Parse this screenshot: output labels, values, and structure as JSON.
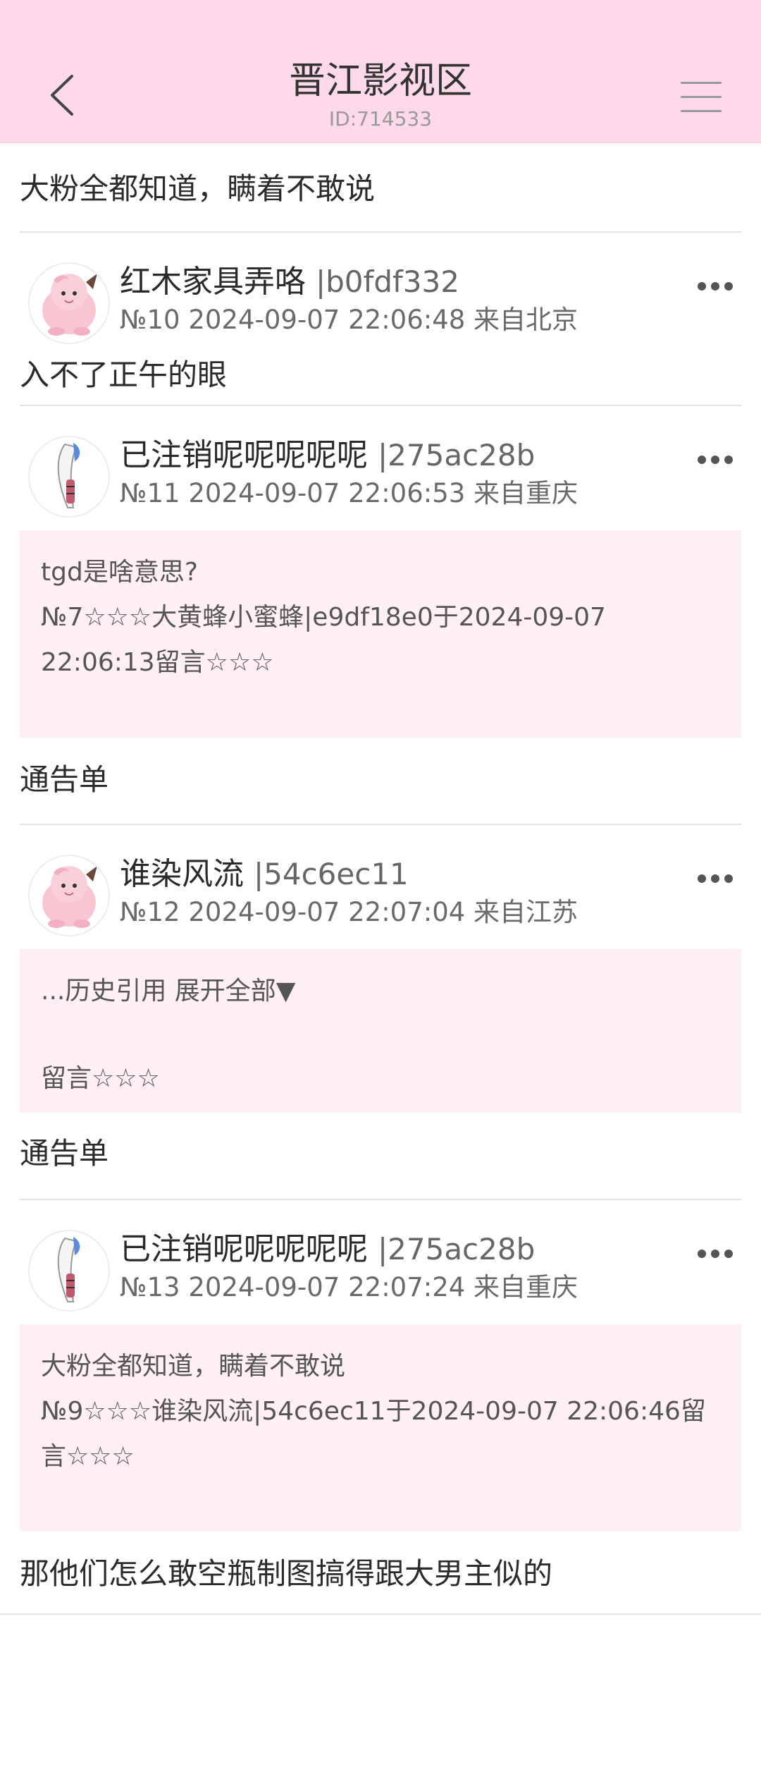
{
  "header": {
    "title": "晋江影视区",
    "id_text": "ID:714533"
  },
  "first_text": "大粉全都知道，瞒着不敢说",
  "posts": [
    {
      "name": "红木家具弄咯",
      "hash": "|b0fdf332",
      "meta": "№10 2024-09-07 22:06:48 来自北京",
      "body": "入不了正午的眼"
    },
    {
      "name": "已注销呢呢呢呢呢",
      "hash": "|275ac28b",
      "meta": "№11 2024-09-07 22:06:53 来自重庆",
      "quote_line1": "tgd是啥意思?",
      "quote_line2": "№7☆☆☆大黄蜂小蜜蜂|e9df18e0于2024-09-07",
      "quote_line3": "22:06:13留言☆☆☆",
      "body": "通告单"
    },
    {
      "name": "谁染风流",
      "hash": "|54c6ec11",
      "meta": "№12 2024-09-07 22:07:04 来自江苏",
      "quote_expand": "...历史引用 展开全部▼",
      "quote_tail": "留言☆☆☆",
      "body": "通告单"
    },
    {
      "name": "已注销呢呢呢呢呢",
      "hash": "|275ac28b",
      "meta": "№13 2024-09-07 22:07:24 来自重庆",
      "quote_line1": "大粉全都知道，瞒着不敢说",
      "quote_line2": "№9☆☆☆谁染风流|54c6ec11于2024-09-07 22:06:46留",
      "quote_line3": "言☆☆☆",
      "body": "那他们怎么敢空瓶制图搞得跟大男主似的"
    }
  ],
  "icons": {
    "back": "chevron-left-icon",
    "menu": "hamburger-menu-icon",
    "more": "more-dots-icon",
    "avatar_pink": "pink-creature-avatar",
    "avatar_feather": "feather-avatar"
  }
}
